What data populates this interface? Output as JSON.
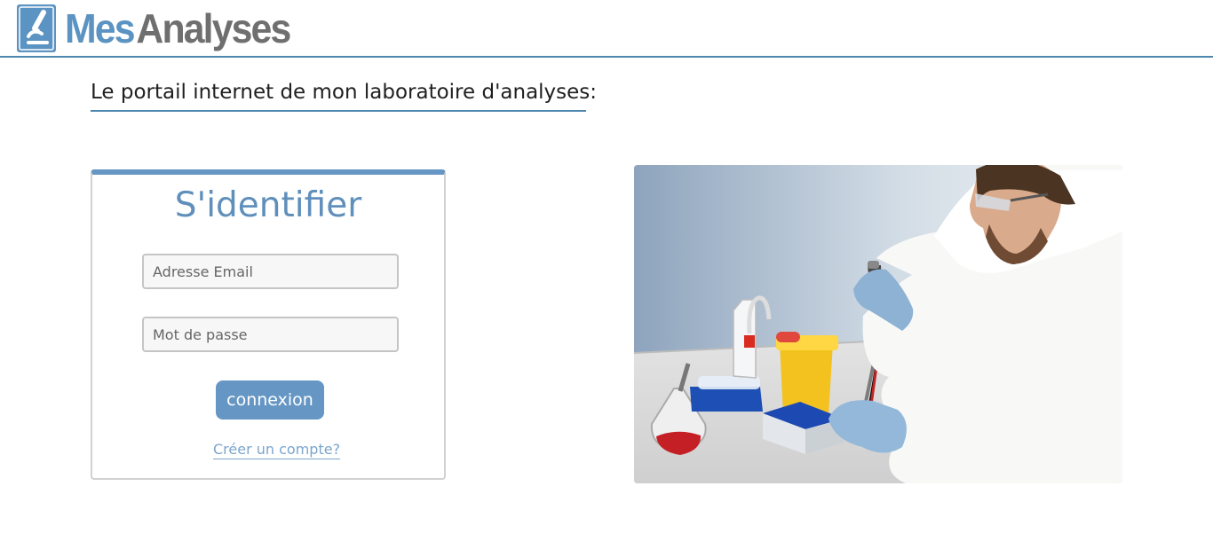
{
  "header": {
    "logo_mes": "Mes",
    "logo_analyses": "Analyses"
  },
  "tagline": "Le portail internet de mon laboratoire d'analyses:",
  "login": {
    "title": "S'identifier",
    "email_placeholder": "Adresse Email",
    "password_placeholder": "Mot de passe",
    "submit_label": "connexion",
    "create_account_label": "Créer un compte?"
  },
  "colors": {
    "accent": "#6596c4",
    "logo_gray": "#6f6f6f",
    "border": "#4d87b0"
  },
  "icons": {
    "logo": "microscope-icon"
  }
}
